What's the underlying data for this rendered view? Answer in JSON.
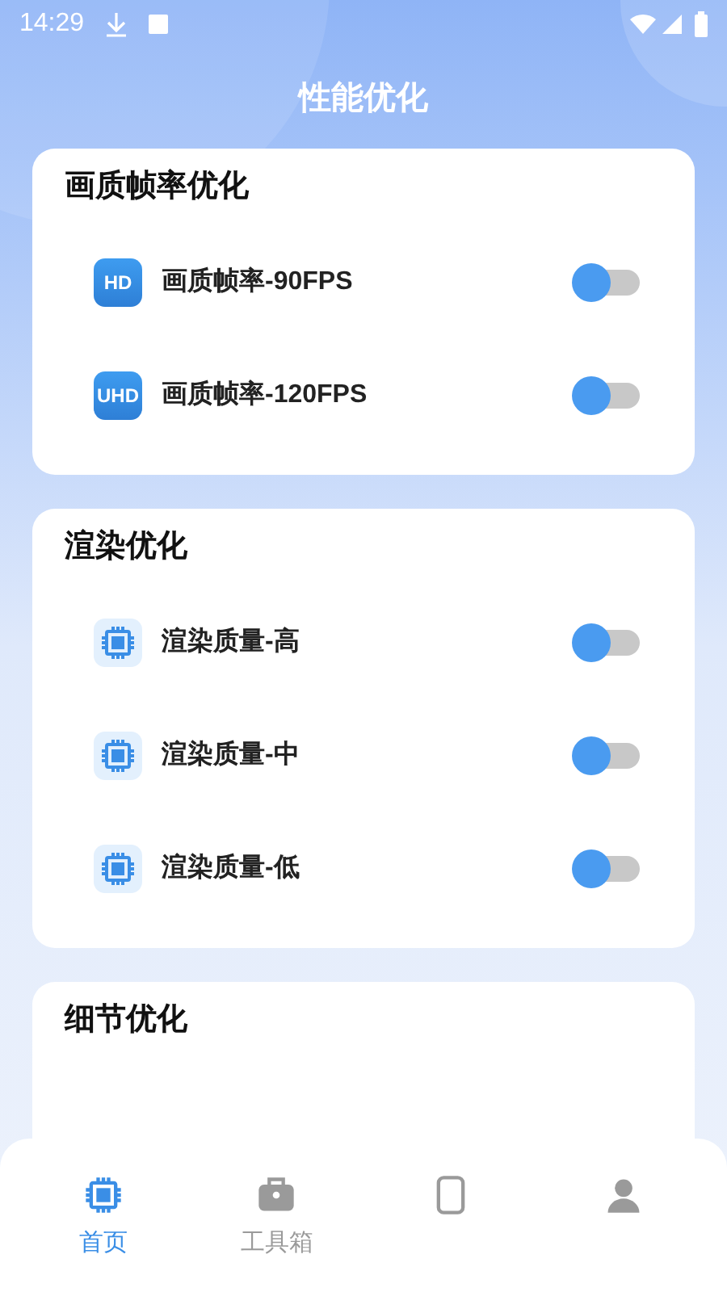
{
  "status_bar": {
    "time": "14:29"
  },
  "title": "性能优化",
  "sections": [
    {
      "title": "画质帧率优化",
      "items": [
        {
          "kind": "badge",
          "icon_text": "HD",
          "label": "画质帧率-90FPS",
          "on": false
        },
        {
          "kind": "badge",
          "icon_text": "UHD",
          "label": "画质帧率-120FPS",
          "on": false
        }
      ]
    },
    {
      "title": "渲染优化",
      "items": [
        {
          "kind": "chip",
          "label": "渲染质量-高",
          "on": false
        },
        {
          "kind": "chip",
          "label": "渲染质量-中",
          "on": false
        },
        {
          "kind": "chip",
          "label": "渲染质量-低",
          "on": false
        }
      ]
    },
    {
      "title": "细节优化"
    }
  ],
  "tabs": [
    {
      "kind": "chip",
      "label": "首页",
      "selected": true
    },
    {
      "kind": "toolbox",
      "label": "工具箱",
      "selected": false
    },
    {
      "kind": "phone",
      "selected": false
    },
    {
      "kind": "user",
      "selected": false
    }
  ]
}
